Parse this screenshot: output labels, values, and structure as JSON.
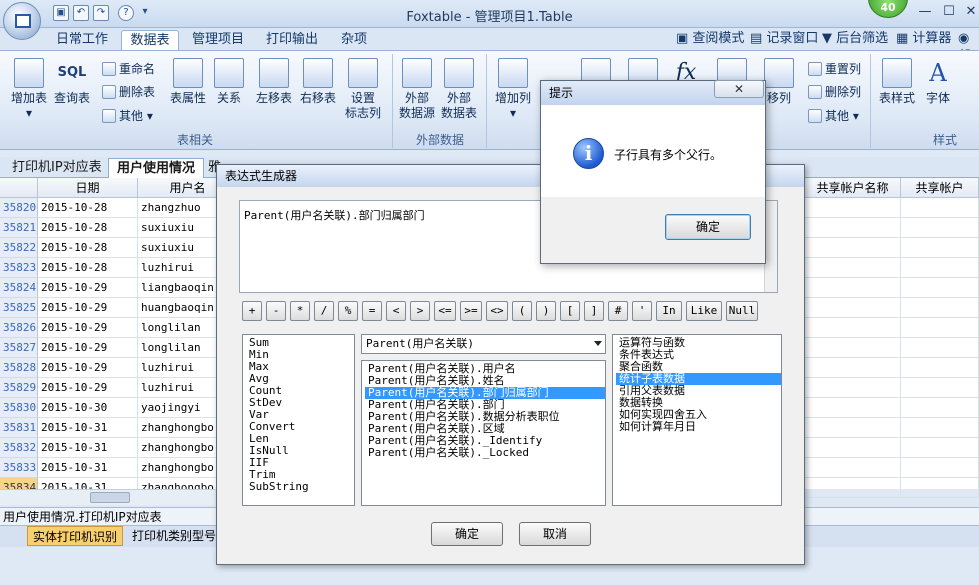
{
  "window": {
    "title": "Foxtable - 管理项目1.Table",
    "badge": "40"
  },
  "ribbon": {
    "tabs": [
      "日常工作",
      "数据表",
      "管理项目",
      "打印输出",
      "杂项"
    ],
    "active_tab": "数据表",
    "right_links": [
      "查阅模式",
      "记录窗口",
      "后台筛选",
      "计算器",
      "帮"
    ],
    "buttons": {
      "add_table": "增加表",
      "query_table": "查询表",
      "sql": "SQL",
      "rename": "重命名",
      "delete_table": "删除表",
      "other1": "其他",
      "table_props": "表属性",
      "relation": "关系",
      "move_left_line1": "左移表",
      "move_right_line1": "右移表",
      "set_flag_line1": "设置",
      "set_flag_line2": "标志列",
      "ext_source_line1": "外部",
      "ext_source_line2": "数据源",
      "ext_table_line1": "外部",
      "ext_table_line2": "数据表",
      "add_column": "增加列",
      "move_column": "移列",
      "reset_column": "重置列",
      "delete_column": "删除列",
      "other2": "其他",
      "table_style": "表样式",
      "font": "字体"
    },
    "groups": {
      "table": "表相关",
      "external": "外部数据",
      "style": "样式"
    }
  },
  "doc_tabs": [
    "打印机IP对应表",
    "用户使用情况",
    "雅"
  ],
  "grid": {
    "headers": {
      "date": "日期",
      "user": "用户名",
      "shared_name": "共享帐户名称",
      "shared_user": "共享帐户"
    },
    "rows": [
      {
        "no": "35820",
        "date": "2015-10-28",
        "user": "zhangzhuo"
      },
      {
        "no": "35821",
        "date": "2015-10-28",
        "user": "suxiuxiu"
      },
      {
        "no": "35822",
        "date": "2015-10-28",
        "user": "suxiuxiu"
      },
      {
        "no": "35823",
        "date": "2015-10-28",
        "user": "luzhirui"
      },
      {
        "no": "35824",
        "date": "2015-10-29",
        "user": "liangbaoqin"
      },
      {
        "no": "35825",
        "date": "2015-10-29",
        "user": "huangbaoqin"
      },
      {
        "no": "35826",
        "date": "2015-10-29",
        "user": "longlilan"
      },
      {
        "no": "35827",
        "date": "2015-10-29",
        "user": "longlilan"
      },
      {
        "no": "35828",
        "date": "2015-10-29",
        "user": "luzhirui"
      },
      {
        "no": "35829",
        "date": "2015-10-29",
        "user": "luzhirui"
      },
      {
        "no": "35830",
        "date": "2015-10-30",
        "user": "yaojingyi"
      },
      {
        "no": "35831",
        "date": "2015-10-31",
        "user": "zhanghongbo"
      },
      {
        "no": "35832",
        "date": "2015-10-31",
        "user": "zhanghongbo"
      },
      {
        "no": "35833",
        "date": "2015-10-31",
        "user": "zhanghongbo"
      },
      {
        "no": "35834",
        "date": "2015-10-31",
        "user": "zhanghongbo"
      }
    ]
  },
  "status_bar": "用户使用情况.打印机IP对应表",
  "bottom_tabs": [
    "实体打印机识别",
    "打印机类别型号"
  ],
  "expr_dialog": {
    "title": "表达式生成器",
    "expression": "Parent(用户名关联).部门归属部门",
    "operators": [
      "+",
      "-",
      "*",
      "/",
      "%",
      "=",
      "<",
      ">",
      "<=",
      ">=",
      "<>",
      "(",
      ")",
      "[",
      "]",
      "#",
      "'",
      "In",
      "Like",
      "Null"
    ],
    "functions": [
      "Sum",
      "Min",
      "Max",
      "Avg",
      "Count",
      "StDev",
      "Var",
      "Convert",
      "Len",
      "IsNull",
      "IIF",
      "Trim",
      "SubString"
    ],
    "dropdown": "Parent(用户名关联)",
    "columns": [
      "Parent(用户名关联).用户名",
      "Parent(用户名关联).姓名",
      "Parent(用户名关联).部门归属部门",
      "Parent(用户名关联).部门",
      "Parent(用户名关联).数据分析表职位",
      "Parent(用户名关联).区域",
      "Parent(用户名关联)._Identify",
      "Parent(用户名关联)._Locked"
    ],
    "selected_column": 2,
    "help": [
      "运算符与函数",
      "条件表达式",
      "聚合函数",
      "统计子表数据",
      "引用父表数据",
      "数据转换",
      "如何实现四舍五入",
      "如何计算年月日"
    ],
    "selected_help": 3,
    "ok": "确定",
    "cancel": "取消"
  },
  "msgbox": {
    "title": "提示",
    "close": "✕",
    "message": "子行具有多个父行。",
    "ok": "确定"
  }
}
